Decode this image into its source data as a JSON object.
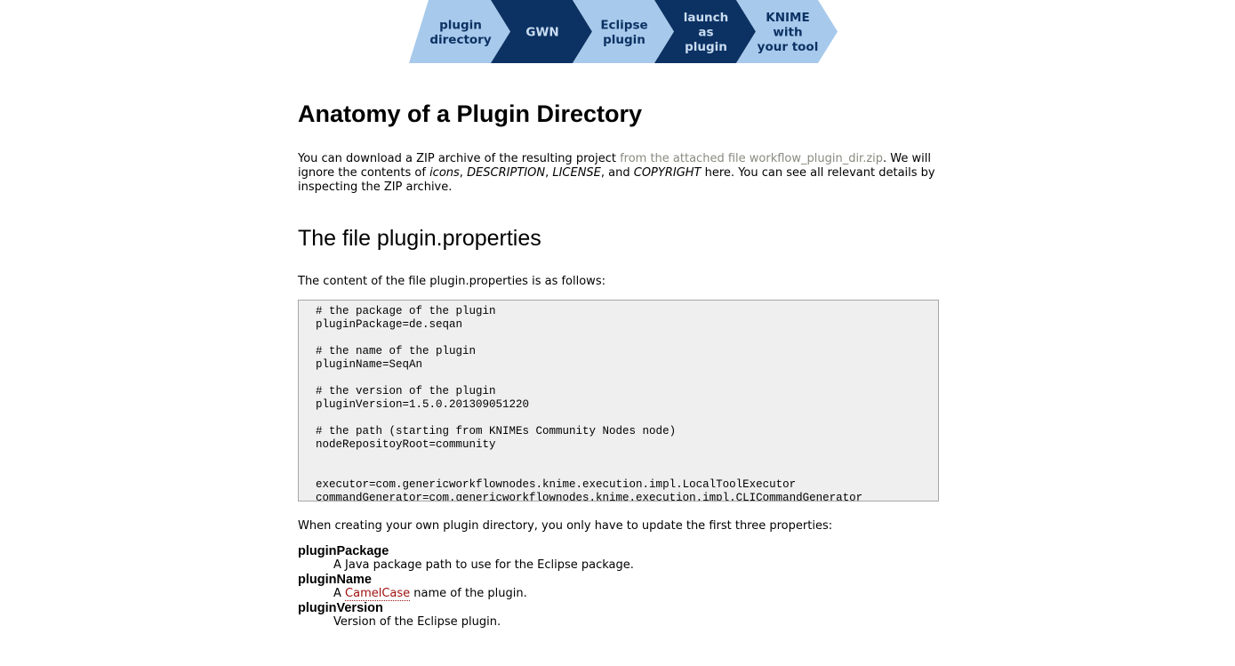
{
  "nav": {
    "steps": [
      {
        "lines": [
          "plugin",
          "directory"
        ],
        "variant": "light"
      },
      {
        "lines": [
          "GWN"
        ],
        "variant": "dark"
      },
      {
        "lines": [
          "Eclipse",
          "plugin"
        ],
        "variant": "light"
      },
      {
        "lines": [
          "launch",
          "as",
          "plugin"
        ],
        "variant": "dark"
      },
      {
        "lines": [
          "KNIME",
          "with",
          "your tool"
        ],
        "variant": "light"
      }
    ],
    "colors": {
      "light": "#a7c9ec",
      "dark": "#0c3263",
      "light_text": "#0c3263",
      "dark_text": "#c9dcf1"
    }
  },
  "page": {
    "title": "Anatomy of a Plugin Directory",
    "intro": {
      "text1": "You can download a ZIP archive of the resulting project ",
      "link": "from the attached file workflow_plugin_dir.zip",
      "text2": ". We will ignore the contents of ",
      "em1": "icons",
      "sep1": ", ",
      "em2": "DESCRIPTION",
      "sep2": ", ",
      "em3": "LICENSE",
      "text3": ", and ",
      "em4": "COPYRIGHT",
      "text4": " here. You can see all relevant details by inspecting the ZIP archive."
    },
    "section_title": "The file plugin.properties",
    "content_line": "The content of the file plugin.properties is as follows:",
    "code": "# the package of the plugin\npluginPackage=de.seqan\n\n# the name of the plugin\npluginName=SeqAn\n\n# the version of the plugin\npluginVersion=1.5.0.201309051220\n\n# the path (starting from KNIMEs Community Nodes node)\nnodeRepositoyRoot=community\n\n\nexecutor=com.genericworkflownodes.knime.execution.impl.LocalToolExecutor\ncommandGenerator=com.genericworkflownodes.knime.execution.impl.CLICommandGenerator",
    "update_line": "When creating your own plugin directory, you only have to update the first three properties:",
    "props": [
      {
        "term": "pluginPackage",
        "desc": "A Java package path to use for the Eclipse package."
      },
      {
        "term": "pluginName",
        "desc_pre": "A ",
        "desc_link": "CamelCase",
        "desc_post": " name of the plugin."
      },
      {
        "term": "pluginVersion",
        "desc": "Version of the Eclipse plugin."
      }
    ]
  }
}
